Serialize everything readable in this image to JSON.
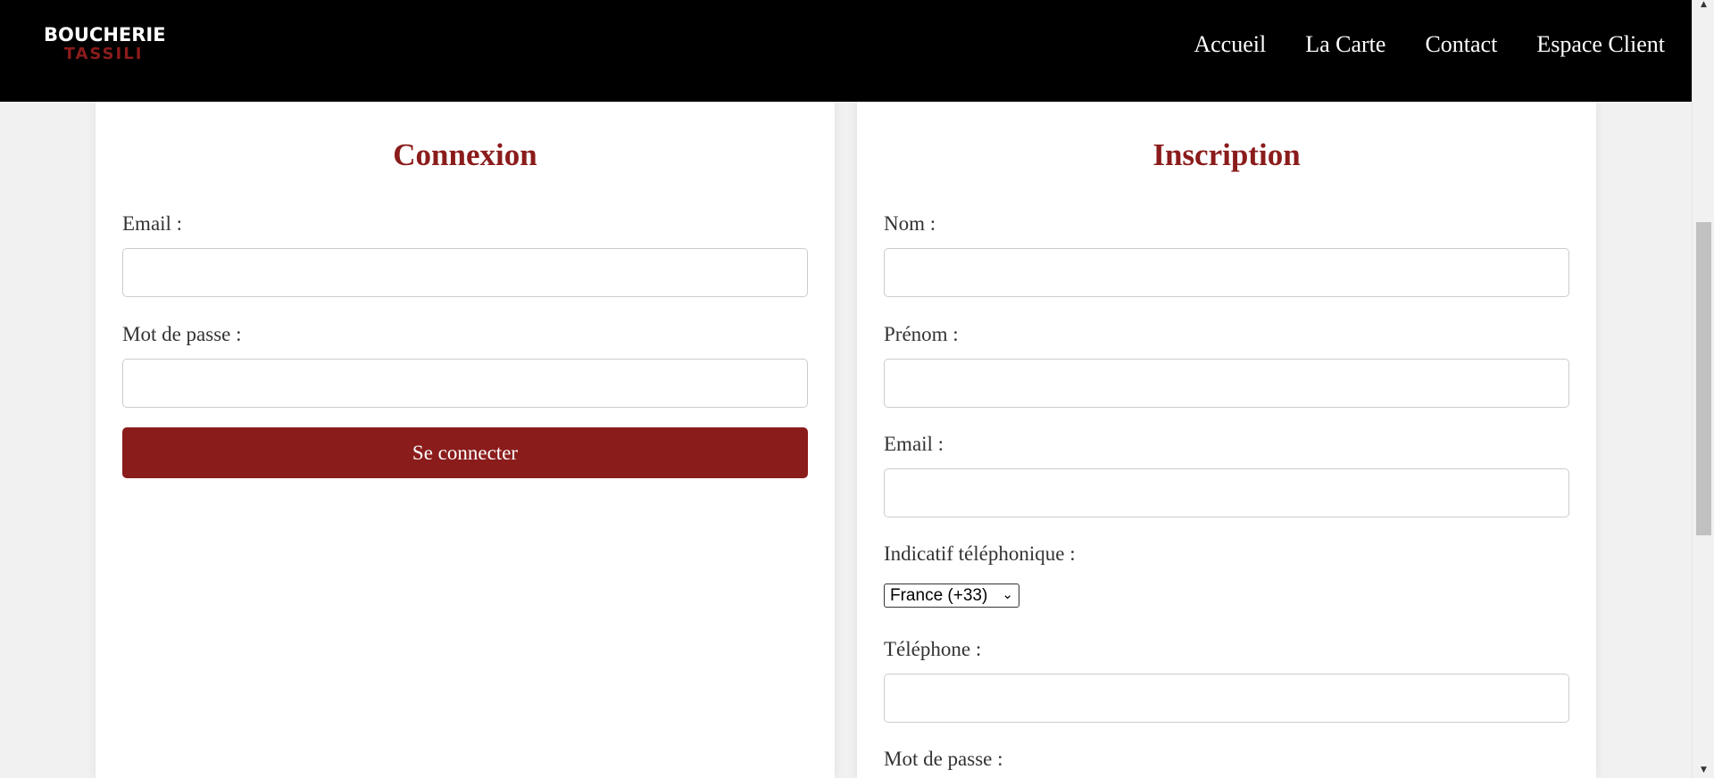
{
  "brand": {
    "line1": "BOUCHERIE",
    "line2": "TASSILI"
  },
  "nav": {
    "items": [
      "Accueil",
      "La Carte",
      "Contact",
      "Espace Client"
    ]
  },
  "login": {
    "title": "Connexion",
    "email_label": "Email :",
    "password_label": "Mot de passe :",
    "submit_label": "Se connecter"
  },
  "register": {
    "title": "Inscription",
    "nom_label": "Nom :",
    "prenom_label": "Prénom :",
    "email_label": "Email :",
    "indicatif_label": "Indicatif téléphonique :",
    "indicatif_selected": "France (+33)",
    "telephone_label": "Téléphone :",
    "password_label": "Mot de passe :"
  },
  "colors": {
    "accent": "#8b1c1c",
    "header_bg": "#000000",
    "page_bg": "#f1f1f1"
  }
}
